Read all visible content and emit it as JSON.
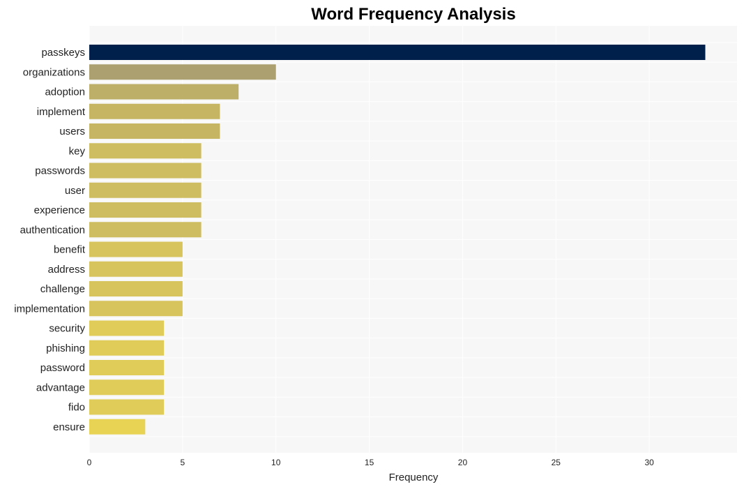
{
  "chart_data": {
    "type": "bar",
    "orientation": "horizontal",
    "title": "Word Frequency Analysis",
    "xlabel": "Frequency",
    "ylabel": "",
    "xlim": [
      0,
      34.7
    ],
    "xticks": [
      0,
      5,
      10,
      15,
      20,
      25,
      30
    ],
    "grid": true,
    "categories": [
      "passkeys",
      "organizations",
      "adoption",
      "implement",
      "users",
      "key",
      "passwords",
      "user",
      "experience",
      "authentication",
      "benefit",
      "address",
      "challenge",
      "implementation",
      "security",
      "phishing",
      "password",
      "advantage",
      "fido",
      "ensure"
    ],
    "values": [
      33,
      10,
      8,
      7,
      7,
      6,
      6,
      6,
      6,
      6,
      5,
      5,
      5,
      5,
      4,
      4,
      4,
      4,
      4,
      3
    ],
    "colors": {
      "max": "#00204c",
      "high": "#aca070",
      "low": "#e8d355",
      "background": "#f7f7f7",
      "grid": "#ffffff"
    }
  }
}
